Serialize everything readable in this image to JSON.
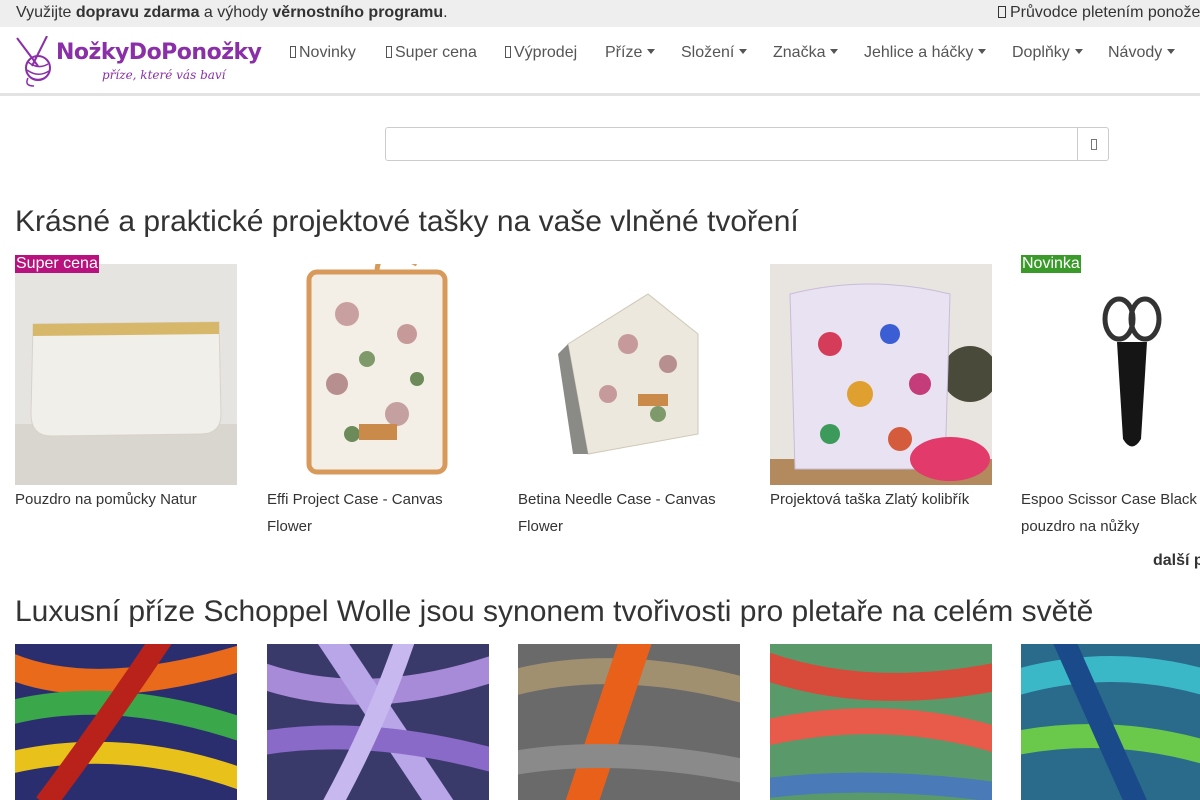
{
  "promo": {
    "prefix": "Využijte ",
    "bold1": "dopravu zdarma",
    "middle": " a výhody ",
    "bold2": "věrnostního programu",
    "suffix": ".",
    "guide_link": "Průvodce pletením ponože"
  },
  "logo": {
    "title": "NožkyDoPonožky",
    "subtitle": "příze, které vás baví"
  },
  "nav": {
    "items": [
      {
        "label": "Novinky"
      },
      {
        "label": "Super cena"
      },
      {
        "label": "Výprodej"
      },
      {
        "label": "Příze"
      },
      {
        "label": "Složení"
      },
      {
        "label": "Značka"
      },
      {
        "label": "Jehlice a háčky"
      },
      {
        "label": "Doplňky"
      },
      {
        "label": "Návody"
      }
    ]
  },
  "search": {
    "placeholder": ""
  },
  "sections": [
    {
      "title": "Krásné a praktické projektové tašky na vaše vlněné tvoření",
      "products": [
        {
          "name": "Pouzdro na pomůcky Natur",
          "badge": "Super cena"
        },
        {
          "name": "Effi Project Case - Canvas Flower",
          "badge": ""
        },
        {
          "name": "Betina Needle Case - Canvas Flower",
          "badge": ""
        },
        {
          "name": "Projektová taška Zlatý kolibřík",
          "badge": ""
        },
        {
          "name": "Espoo Scissor Case Black - pouzdro na nůžky",
          "badge": "Novinka"
        }
      ],
      "more": "další p"
    },
    {
      "title": "Luxusní příze Schoppel Wolle jsou synonem tvořivosti pro pletaře na celém světě"
    }
  ],
  "colors": {
    "brand": "#8a2fa8",
    "badge_sale": "#b8127e",
    "badge_new": "#3a9b2b"
  }
}
